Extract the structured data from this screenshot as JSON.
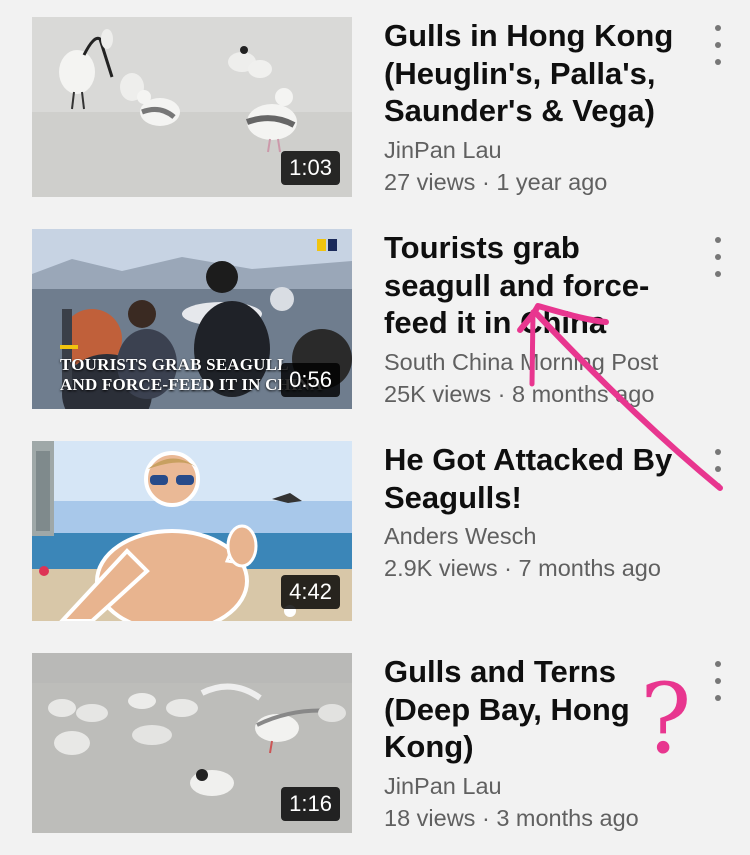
{
  "colors": {
    "annotation": "#e8368f",
    "background": "#f2f2f2"
  },
  "videos": [
    {
      "title": "Gulls in Hong Kong (Heuglin's, Palla's, Saunder's & Vega)",
      "channel": "JinPan Lau",
      "stats": "27 views · 1 year ago",
      "duration": "1:03"
    },
    {
      "title": "Tourists grab seagull and force-feed it in China",
      "channel": "South China Morning Post",
      "stats": "25K views · 8 months ago",
      "duration": "0:56",
      "thumb_text_line1": "TOURISTS GRAB SEAGULL",
      "thumb_text_line2": "AND FORCE-FEED IT IN CHINA"
    },
    {
      "title": "He Got Attacked By Seagulls!",
      "channel": "Anders Wesch",
      "stats": "2.9K views · 7 months ago",
      "duration": "4:42"
    },
    {
      "title": "Gulls and Terns (Deep Bay, Hong Kong)",
      "channel": "JinPan Lau",
      "stats": "18 views · 3 months ago",
      "duration": "1:16"
    }
  ],
  "annotation": {
    "question_mark": "?"
  }
}
